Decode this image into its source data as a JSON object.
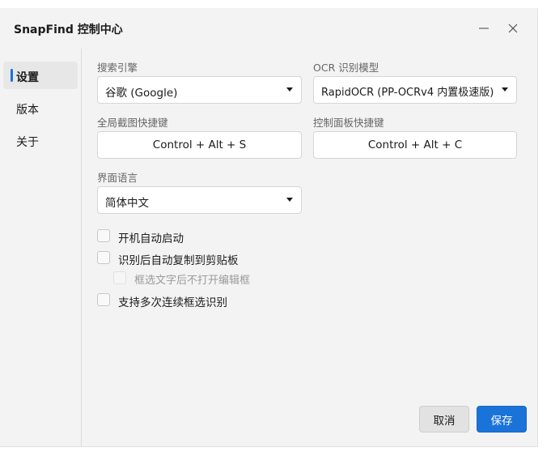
{
  "window": {
    "title": "SnapFind 控制中心"
  },
  "sidebar": {
    "items": [
      {
        "label": "设置",
        "active": true
      },
      {
        "label": "版本",
        "active": false
      },
      {
        "label": "关于",
        "active": false
      }
    ]
  },
  "settings": {
    "search_engine": {
      "label": "搜索引擎",
      "value": "谷歌 (Google)"
    },
    "ocr_model": {
      "label": "OCR 识别模型",
      "value": "RapidOCR (PP-OCRv4 内置极速版)"
    },
    "global_hotkey": {
      "label": "全局截图快捷键",
      "value": "Control + Alt + S"
    },
    "panel_hotkey": {
      "label": "控制面板快捷键",
      "value": "Control + Alt + C"
    },
    "language": {
      "label": "界面语言",
      "value": "简体中文"
    },
    "options": {
      "autostart": {
        "label": "开机自动启动",
        "checked": false
      },
      "auto_copy": {
        "label": "识别后自动复制到剪贴板",
        "checked": false
      },
      "no_editor": {
        "label": "框选文字后不打开编辑框",
        "checked": false,
        "disabled": true
      },
      "multi_select": {
        "label": "支持多次连续框选识别",
        "checked": false
      }
    }
  },
  "footer": {
    "cancel_label": "取消",
    "save_label": "保存"
  },
  "colors": {
    "accent": "#1a73d9",
    "window_bg": "#f3f3f3"
  },
  "icons": {
    "minimize": "minimize-icon",
    "close": "close-icon",
    "dropdown": "chevron-down-icon"
  }
}
